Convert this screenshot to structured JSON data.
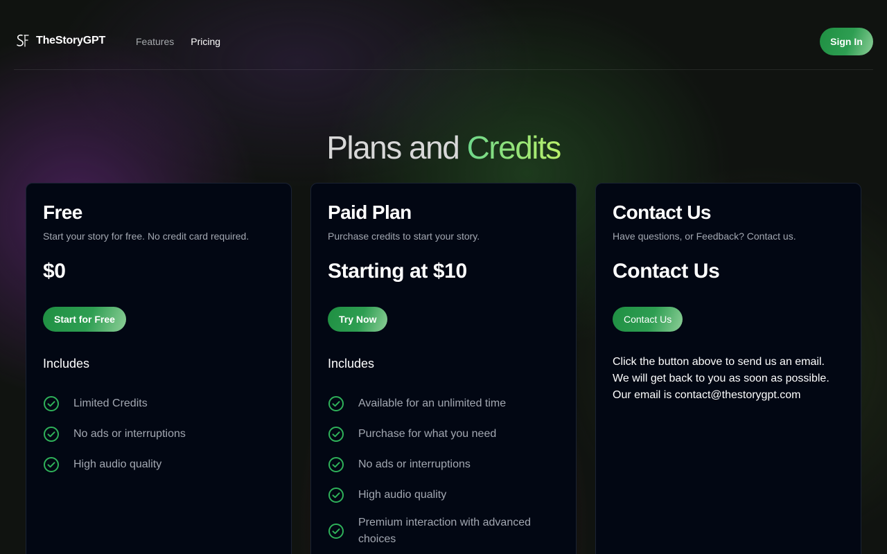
{
  "header": {
    "brand_name": "TheStoryGPT",
    "nav": [
      {
        "label": "Features"
      },
      {
        "label": "Pricing"
      }
    ],
    "signin_label": "Sign In"
  },
  "heading": {
    "part1": "Plans and ",
    "part2": "Credits"
  },
  "colors": {
    "accent_green": "#2e9e52",
    "check_green": "#2fb25a",
    "card_bg": "#020713"
  },
  "cards": [
    {
      "title": "Free",
      "subtitle": "Start your story for free. No credit card required.",
      "price": "$0",
      "button": "Start for Free",
      "includes_label": "Includes",
      "features": [
        "Limited Credits",
        "No ads or interruptions",
        "High audio quality"
      ]
    },
    {
      "title": "Paid Plan",
      "subtitle": "Purchase credits to start your story.",
      "price": "Starting at $10",
      "button": "Try Now",
      "includes_label": "Includes",
      "features": [
        "Available for an unlimited time",
        "Purchase for what you need",
        "No ads or interruptions",
        "High audio quality",
        "Premium interaction with advanced choices"
      ]
    },
    {
      "title": "Contact Us",
      "subtitle": "Have questions, or Feedback? Contact us.",
      "price": "Contact Us",
      "button": "Contact Us",
      "body_lines": [
        "Click the button above to send us an email.",
        "We will get back to you as soon as possible.",
        "Our email is contact@thestorygpt.com"
      ]
    }
  ]
}
